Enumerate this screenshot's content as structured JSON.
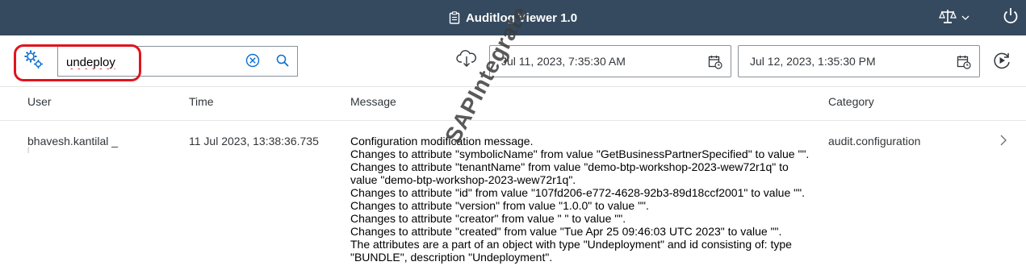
{
  "shell": {
    "title": "Auditlog Viewer 1.0",
    "icons": [
      "document-icon",
      "scale-icon",
      "chevron-down-icon",
      "power-icon"
    ]
  },
  "toolbar": {
    "search": {
      "value": "undeploy",
      "placeholder": ""
    },
    "date_from": "Jul 11, 2023, 7:35:30 AM",
    "date_to": "Jul 12, 2023, 1:35:30 PM",
    "icons": [
      "settings-icon",
      "clear-icon",
      "search-icon",
      "cloud-download-icon",
      "calendar-icon",
      "play-icon"
    ]
  },
  "table": {
    "columns": {
      "user": "User",
      "time": "Time",
      "message": "Message",
      "category": "Category"
    },
    "rows": [
      {
        "user": "bhavesh.kantilal _",
        "time": "11 Jul 2023, 13:38:36.735",
        "message_lines": [
          "Configuration modification message.",
          "Changes to attribute \"symbolicName\" from value \"GetBusinessPartnerSpecified\" to value \"\".",
          "Changes to attribute \"tenantName\" from value \"demo-btp-workshop-2023-wew72r1q\" to",
          "value \"demo-btp-workshop-2023-wew72r1q\".",
          "Changes to attribute \"id\" from value \"107fd206-e772-4628-92b3-89d18ccf2001\" to value \"\".",
          "Changes to attribute \"version\" from value \"1.0.0\" to value \"\".",
          "Changes to attribute \"creator\" from value \"                    \" to value \"\".",
          "Changes to attribute \"created\" from value \"Tue Apr 25 09:46:03 UTC 2023\" to value \"\".",
          "The attributes are a part of an object with type \"Undeployment\" and id consisting of: type",
          "\"BUNDLE\", description \"Undeployment\"."
        ],
        "category": "audit.configuration"
      }
    ]
  },
  "watermark": "SAPIntegrate",
  "colors": {
    "shell_bg": "#354a5f",
    "highlight": "#e0141e",
    "accent": "#0a6ed1"
  }
}
